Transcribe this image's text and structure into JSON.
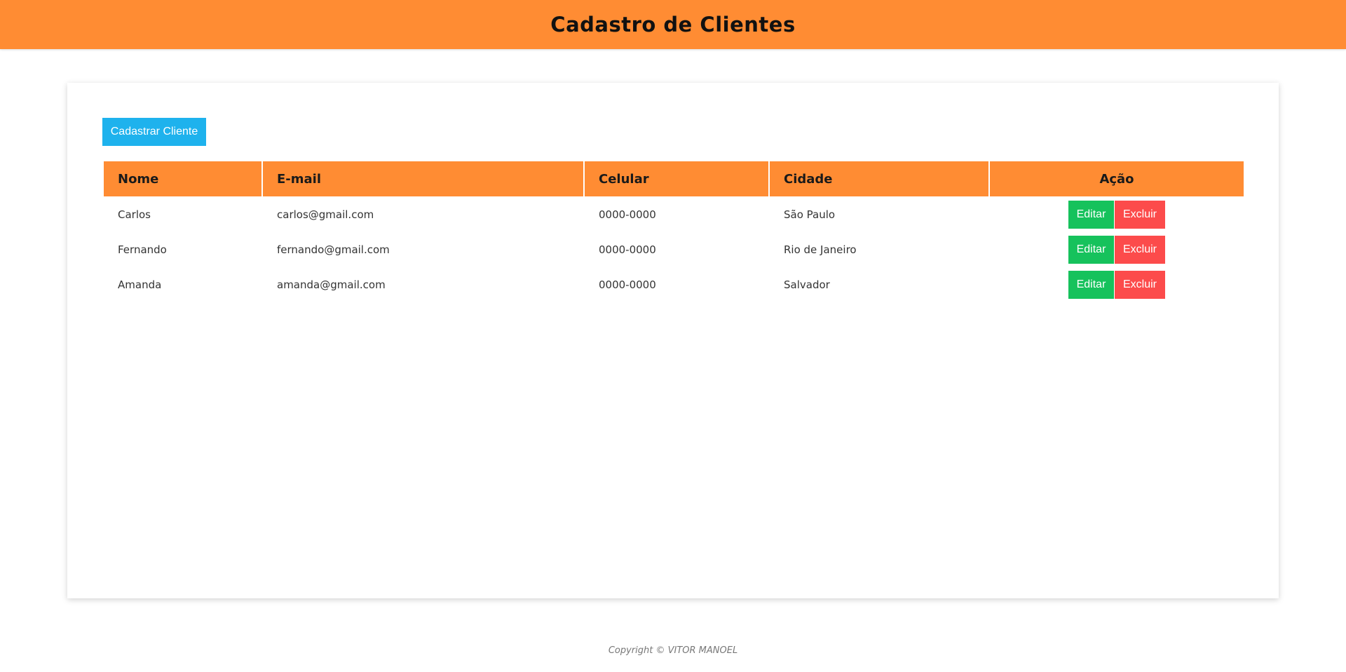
{
  "header": {
    "title": "Cadastro de Clientes"
  },
  "main": {
    "add_button_label": "Cadastrar Cliente",
    "table": {
      "columns": [
        "Nome",
        "E-mail",
        "Celular",
        "Cidade",
        "Ação"
      ],
      "rows": [
        {
          "nome": "Carlos",
          "email": "carlos@gmail.com",
          "celular": "0000-0000",
          "cidade": "São Paulo",
          "edit_label": "Editar",
          "delete_label": "Excluir"
        },
        {
          "nome": "Fernando",
          "email": "fernando@gmail.com",
          "celular": "0000-0000",
          "cidade": "Rio de Janeiro",
          "edit_label": "Editar",
          "delete_label": "Excluir"
        },
        {
          "nome": "Amanda",
          "email": "amanda@gmail.com",
          "celular": "0000-0000",
          "cidade": "Salvador",
          "edit_label": "Editar",
          "delete_label": "Excluir"
        }
      ]
    }
  },
  "footer": {
    "copyright": "Copyright © VITOR MANOEL"
  },
  "colors": {
    "accent": "#ff8c33",
    "primary_button": "#1eb2ed",
    "edit_button": "#16c25c",
    "delete_button": "#fc4b4b"
  }
}
